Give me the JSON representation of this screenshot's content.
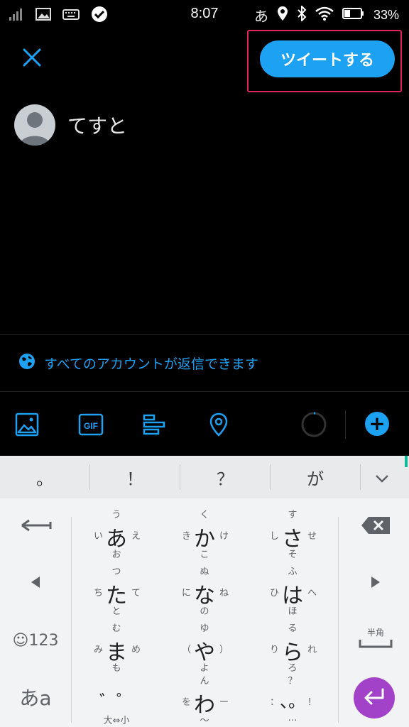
{
  "status_bar": {
    "time": "8:07",
    "ime_indicator": "あ",
    "battery_percent": "33%",
    "icons": [
      "signal-icon",
      "image-icon",
      "keyboard-icon",
      "check-circle-icon",
      "location-icon",
      "bluetooth-icon",
      "wifi-icon",
      "battery-icon"
    ]
  },
  "compose": {
    "tweet_button_label": "ツイートする",
    "text": "てすと",
    "reply_setting": "すべてのアカウントが返信できます"
  },
  "toolbar": {
    "icons": [
      "image-icon",
      "gif-icon",
      "poll-icon",
      "location-icon",
      "character-counter-icon",
      "add-icon"
    ],
    "gif_label": "GIF",
    "add_label": "+"
  },
  "keyboard": {
    "candidates": [
      "。",
      "！",
      "？",
      "が"
    ],
    "rows": [
      [
        {
          "main": "あ",
          "top": "う",
          "left": "い",
          "right": "え",
          "bottom": "お"
        },
        {
          "main": "か",
          "top": "く",
          "left": "き",
          "right": "け",
          "bottom": "こ"
        },
        {
          "main": "さ",
          "top": "す",
          "left": "し",
          "right": "せ",
          "bottom": "そ"
        }
      ],
      [
        {
          "main": "た",
          "top": "つ",
          "left": "ち",
          "right": "て",
          "bottom": "と"
        },
        {
          "main": "な",
          "top": "ぬ",
          "left": "に",
          "right": "ね",
          "bottom": "の"
        },
        {
          "main": "は",
          "top": "ふ",
          "left": "ひ",
          "right": "へ",
          "bottom": "ほ"
        }
      ],
      [
        {
          "main": "ま",
          "top": "む",
          "left": "み",
          "right": "め",
          "bottom": "も"
        },
        {
          "main": "や",
          "top": "ゆ",
          "left": "（",
          "right": "）",
          "bottom": "よ"
        },
        {
          "main": "ら",
          "top": "る",
          "left": "り",
          "right": "れ",
          "bottom": "ろ"
        }
      ],
      [
        {
          "main": "゛゜",
          "top": "",
          "left": "",
          "right": "",
          "bottom": "大⇔小"
        },
        {
          "main": "わ",
          "top": "ん",
          "left": "を",
          "right": "ー",
          "bottom": "〜"
        },
        {
          "main": "、。",
          "top": "？",
          "left": "：",
          "right": "！",
          "bottom": "…"
        }
      ]
    ],
    "left_keys": {
      "emoji_num": "☺123",
      "mode": "あa"
    },
    "right_keys": {
      "space_hint": "半角"
    },
    "accent_color": "#a142c9"
  },
  "colors": {
    "twitter_blue": "#1da1f2",
    "highlight_border": "#e0245e"
  }
}
